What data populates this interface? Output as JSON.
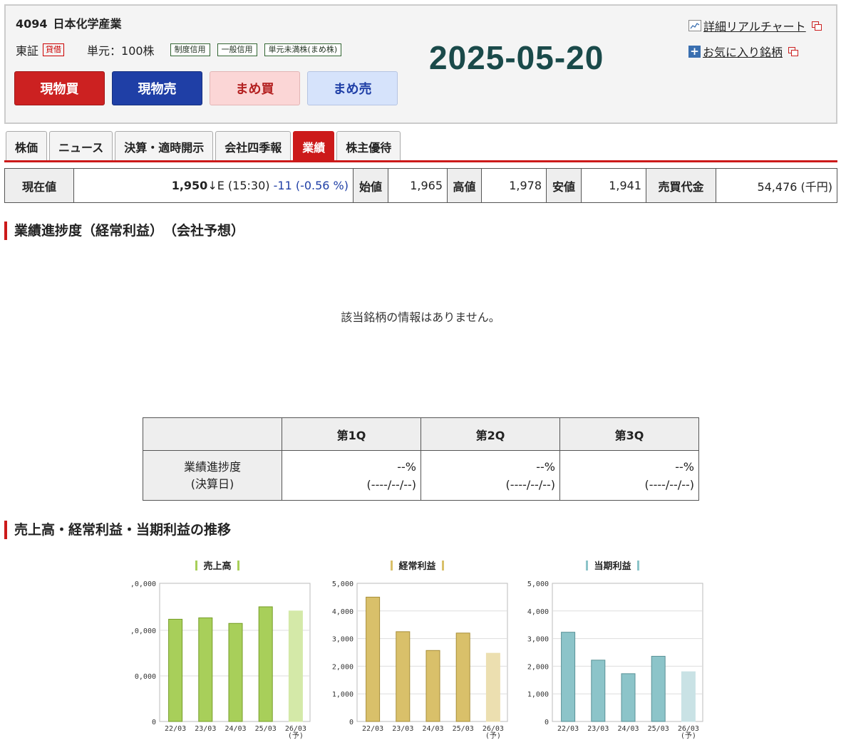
{
  "header": {
    "code": "4094",
    "name": "日本化学産業",
    "exchange": "東証",
    "exchange_badge": "貸借",
    "unit": "単元：100株",
    "tags": [
      "制度信用",
      "一般信用",
      "単元未満株(まめ株)"
    ],
    "buttons": [
      "現物買",
      "現物売",
      "まめ買",
      "まめ売"
    ],
    "date": "2025-05-20",
    "link_chart": "詳細リアルチャート",
    "link_fav": "お気に入り銘柄"
  },
  "tabs": [
    {
      "label": "株価",
      "active": false
    },
    {
      "label": "ニュース",
      "active": false
    },
    {
      "label": "決算・適時開示",
      "active": false
    },
    {
      "label": "会社四季報",
      "active": false
    },
    {
      "label": "業績",
      "active": true
    },
    {
      "label": "株主優待",
      "active": false
    }
  ],
  "price": {
    "current_label": "現在値",
    "current_value": "1,950",
    "current_suffix": "↓E (15:30)",
    "change": "-11 (-0.56 %)",
    "open_label": "始値",
    "open_value": "1,965",
    "high_label": "高値",
    "high_value": "1,978",
    "low_label": "安値",
    "low_value": "1,941",
    "turnover_label": "売買代金",
    "turnover_value": "54,476 (千円)"
  },
  "progress_section": {
    "title": "業績進捗度（経常利益）　（会社予想）",
    "no_info": "該当銘柄の情報はありません。",
    "columns": [
      "第1Q",
      "第2Q",
      "第3Q"
    ],
    "row_label_1": "業績進捗度",
    "row_label_2": "(決算日)",
    "percent": "--%",
    "date": "(----/--/--)"
  },
  "trend_section": {
    "title": "売上高・経常利益・当期利益の推移"
  },
  "chart_data": [
    {
      "type": "bar",
      "title": "売上高",
      "color": "#a8cf5a",
      "forecast_color": "#d4e9a8",
      "categories": [
        "22/03",
        "23/03",
        "24/03",
        "25/03",
        "26/03"
      ],
      "forecast_label": "(予)",
      "ytick_labels": [
        ",0,000",
        ",0,000",
        "0,000",
        "0"
      ],
      "ytick_fracs": [
        1,
        0.66,
        0.33,
        0
      ],
      "values_frac": [
        0.74,
        0.75,
        0.71,
        0.83,
        0.8
      ]
    },
    {
      "type": "bar",
      "title": "経常利益",
      "color": "#d9c06a",
      "forecast_color": "#ecdfb0",
      "categories": [
        "22/03",
        "23/03",
        "24/03",
        "25/03",
        "26/03"
      ],
      "forecast_label": "(予)",
      "ylim": [
        0,
        5000
      ],
      "ytick_labels": [
        "5,000",
        "4,000",
        "3,000",
        "2,000",
        "1,000",
        "0"
      ],
      "values": [
        4500,
        3250,
        2570,
        3200,
        2470
      ]
    },
    {
      "type": "bar",
      "title": "当期利益",
      "color": "#8cc4c9",
      "forecast_color": "#c9e2e5",
      "categories": [
        "22/03",
        "23/03",
        "24/03",
        "25/03",
        "26/03"
      ],
      "forecast_label": "(予)",
      "ylim": [
        0,
        5000
      ],
      "ytick_labels": [
        "5,000",
        "4,000",
        "3,000",
        "2,000",
        "1,000",
        "0"
      ],
      "values": [
        3230,
        2220,
        1730,
        2360,
        1800
      ]
    }
  ]
}
